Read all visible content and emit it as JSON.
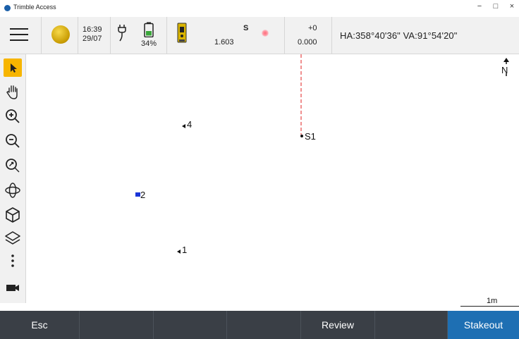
{
  "window": {
    "title": "Trimble Access",
    "controls": {
      "minimize": "−",
      "maximize": "□",
      "close": "×"
    }
  },
  "status": {
    "time": "16:39",
    "date": "29/07",
    "battery_percent": "34%",
    "face": "S",
    "distance": "1.603",
    "prism_constant": "+0",
    "ppm": "0.000",
    "angles": "HA:358°40'36\"  VA:91°54'20\""
  },
  "toolbar": {
    "icons": [
      "select-arrow-icon",
      "pan-hand-icon",
      "zoom-in-icon",
      "zoom-out-icon",
      "zoom-extents-icon",
      "orbit-icon",
      "3d-cube-icon",
      "layers-icon",
      "more-icon",
      "camera-icon"
    ]
  },
  "map": {
    "north": "N",
    "points": [
      {
        "label": "4"
      },
      {
        "label": "S1"
      },
      {
        "label": "2"
      },
      {
        "label": "1"
      }
    ],
    "scale": "1m"
  },
  "softkeys": {
    "esc": "Esc",
    "k2": "",
    "k3": "",
    "k4": "",
    "review": "Review",
    "k6": "",
    "stakeout": "Stakeout"
  },
  "colors": {
    "accent": "#f7b500",
    "primary": "#1e6fb3",
    "softkey_bar": "#3a3f46",
    "station_line": "#e02020",
    "selected_point": "#1a35d8"
  }
}
